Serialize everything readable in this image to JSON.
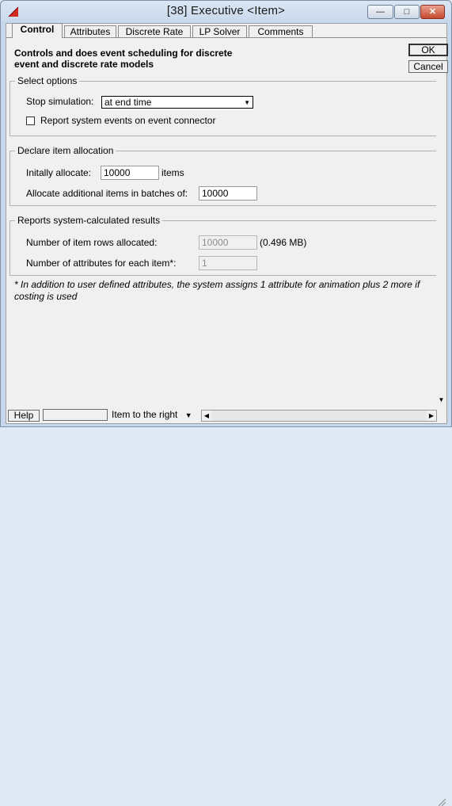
{
  "window": {
    "title": "[38]   Executive   <Item>",
    "min_glyph": "—",
    "max_glyph": "□",
    "close_glyph": "✕"
  },
  "tabs": [
    {
      "label": "Control",
      "active": true
    },
    {
      "label": "Attributes",
      "active": false
    },
    {
      "label": "Discrete Rate",
      "active": false
    },
    {
      "label": "LP Solver",
      "active": false
    },
    {
      "label": "Comments",
      "active": false
    }
  ],
  "description": "Controls and does event scheduling for discrete event and discrete rate models",
  "buttons": {
    "ok": "OK",
    "cancel": "Cancel"
  },
  "select_options": {
    "legend": "Select options",
    "stop_label": "Stop simulation:",
    "stop_value": "at end time",
    "report_label": "Report system events on event connector",
    "report_checked": false
  },
  "allocation": {
    "legend": "Declare item allocation",
    "initially_label": "Initally allocate:",
    "initially_value": "10000",
    "items_unit": "items",
    "batch_label": "Allocate additional items in batches of:",
    "batch_value": "10000"
  },
  "reports": {
    "legend": "Reports system-calculated results",
    "rows_label": "Number of item rows allocated:",
    "rows_value": "10000",
    "rows_size": "(0.496 MB)",
    "attrs_label": "Number of attributes for each item*:",
    "attrs_value": "1"
  },
  "footnote": "* In addition to user defined attributes, the system assigns 1 attribute for animation plus 2 more if costing is used",
  "statusbar": {
    "help": "Help",
    "item_nav": "Item to the right",
    "dropdown_glyph": "▼",
    "left_glyph": "◀",
    "right_glyph": "▶",
    "down_glyph": "▼"
  },
  "colors": {
    "accent": "#c0392b",
    "panel": "#f0f0f0",
    "titlebar": "#c7d8ec"
  }
}
